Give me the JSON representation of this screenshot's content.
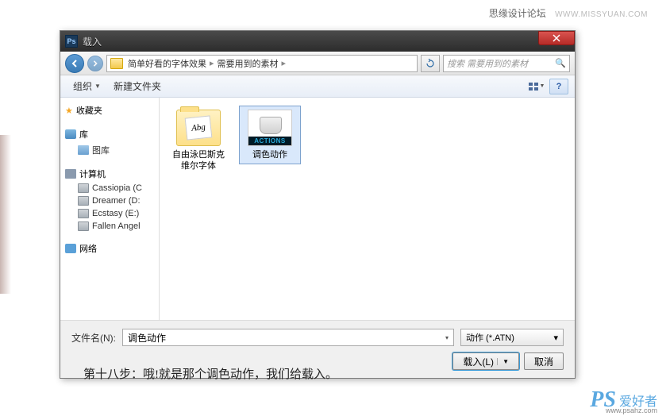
{
  "header": {
    "forum": "思缘设计论坛",
    "url": "WWW.MISSYUAN.COM"
  },
  "dialog": {
    "title": "载入",
    "breadcrumb": {
      "seg1": "简单好看的字体效果",
      "seg2": "需要用到的素材"
    },
    "search_placeholder": "搜索 需要用到的素材",
    "toolbar": {
      "organize": "组织",
      "newfolder": "新建文件夹"
    },
    "sidebar": {
      "favorites": "收藏夹",
      "library": "库",
      "gallery": "图库",
      "computer": "计算机",
      "drives": [
        "Cassiopia (C",
        "Dreamer (D:",
        "Ecstasy (E:)",
        "Fallen Angel"
      ],
      "network": "网络"
    },
    "files": {
      "font_folder": "自由泳巴斯克维尔字体",
      "font_abg": "Abg",
      "action_label": "ACTIONS",
      "action_name": "调色动作"
    },
    "footer": {
      "filename_label": "文件名(N):",
      "filename_value": "调色动作",
      "filetype": "动作 (*.ATN)",
      "load_btn": "载入(L)",
      "cancel_btn": "取消"
    }
  },
  "caption": "第十八步：哦!就是那个调色动作，我们给载入。",
  "watermark": {
    "ps": "PS",
    "txt": "爱好者",
    "url": "www.psahz.com"
  }
}
